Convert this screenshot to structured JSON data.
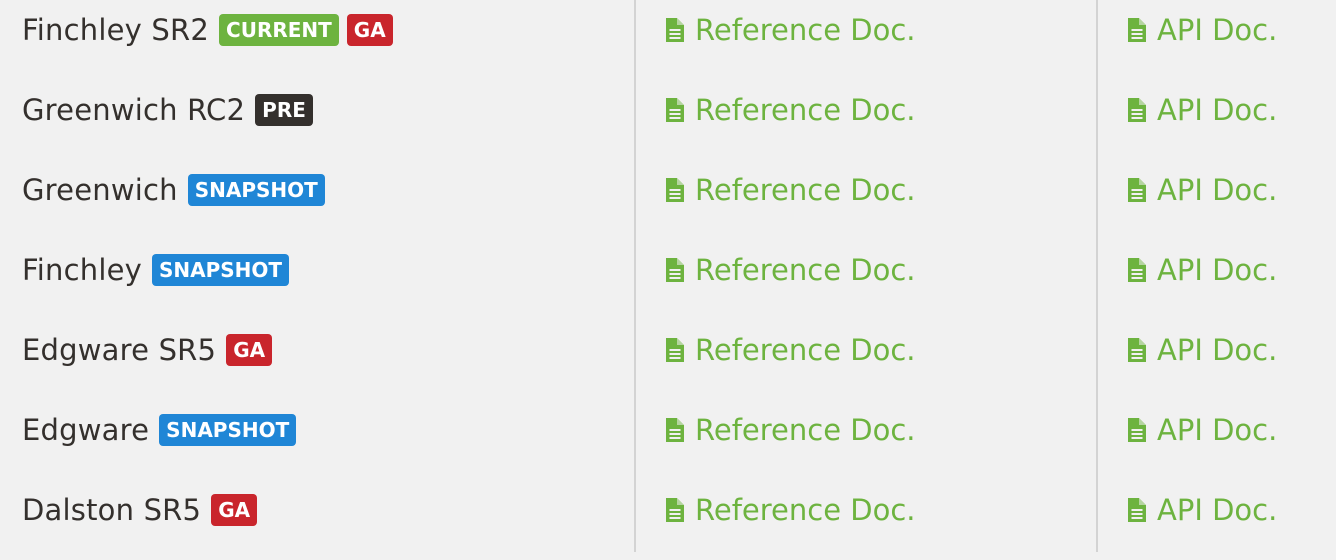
{
  "colors": {
    "current": "#6db33f",
    "ga": "#c9252c",
    "pre": "#34302d",
    "snapshot": "#1f86d6",
    "link": "#6db33f"
  },
  "link_icon": "file-text-icon",
  "rows": [
    {
      "name": "Finchley SR2",
      "badges": [
        {
          "label": "CURRENT",
          "kind": "current"
        },
        {
          "label": "GA",
          "kind": "ga"
        }
      ],
      "ref_label": "Reference Doc.",
      "api_label": "API Doc."
    },
    {
      "name": "Greenwich RC2",
      "badges": [
        {
          "label": "PRE",
          "kind": "pre"
        }
      ],
      "ref_label": "Reference Doc.",
      "api_label": "API Doc."
    },
    {
      "name": "Greenwich",
      "badges": [
        {
          "label": "SNAPSHOT",
          "kind": "snapshot"
        }
      ],
      "ref_label": "Reference Doc.",
      "api_label": "API Doc."
    },
    {
      "name": "Finchley",
      "badges": [
        {
          "label": "SNAPSHOT",
          "kind": "snapshot"
        }
      ],
      "ref_label": "Reference Doc.",
      "api_label": "API Doc."
    },
    {
      "name": "Edgware SR5",
      "badges": [
        {
          "label": "GA",
          "kind": "ga"
        }
      ],
      "ref_label": "Reference Doc.",
      "api_label": "API Doc."
    },
    {
      "name": "Edgware",
      "badges": [
        {
          "label": "SNAPSHOT",
          "kind": "snapshot"
        }
      ],
      "ref_label": "Reference Doc.",
      "api_label": "API Doc."
    },
    {
      "name": "Dalston SR5",
      "badges": [
        {
          "label": "GA",
          "kind": "ga"
        }
      ],
      "ref_label": "Reference Doc.",
      "api_label": "API Doc."
    }
  ]
}
